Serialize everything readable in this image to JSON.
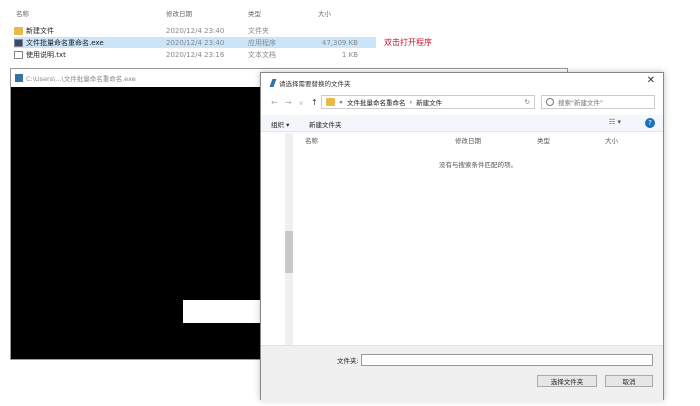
{
  "explorer": {
    "columns": {
      "name": "名称",
      "date": "修改日期",
      "type": "类型",
      "size": "大小"
    },
    "rows": [
      {
        "name": "新建文件",
        "date": "2020/12/4 23:40",
        "type": "文件夹",
        "size": ""
      },
      {
        "name": "文件批量命名重命名.exe",
        "date": "2020/12/4 23:40",
        "type": "应用程序",
        "size": "47,309 KB"
      },
      {
        "name": "使用说明.txt",
        "date": "2020/12/4 23:16",
        "type": "文本文档",
        "size": "1 KB"
      }
    ],
    "annotation": "双击打开程序"
  },
  "console": {
    "title": "C:\\Users\\...\\文件批量命名重命名.exe"
  },
  "dialog": {
    "title": "请选择需要替换的文件夹",
    "close": "✕",
    "nav": {
      "back": "←",
      "forward": "→",
      "recent": "∨",
      "up": "↑"
    },
    "breadcrumb": [
      "«",
      "文件批量命名重命名",
      "›",
      "新建文件"
    ],
    "refresh": "↻",
    "search_placeholder": "搜索\"新建文件\"",
    "toolbar": {
      "organize": "组织 ▾",
      "new_folder": "新建文件夹",
      "view": "☷ ▾",
      "help": "?"
    },
    "columns": {
      "name": "名称",
      "date": "修改日期",
      "type": "类型",
      "size": "大小"
    },
    "empty_message": "没有与搜索条件匹配的项。",
    "folder_label": "文件夹:",
    "folder_value": "",
    "select_button": "选择文件夹",
    "cancel_button": "取消"
  }
}
